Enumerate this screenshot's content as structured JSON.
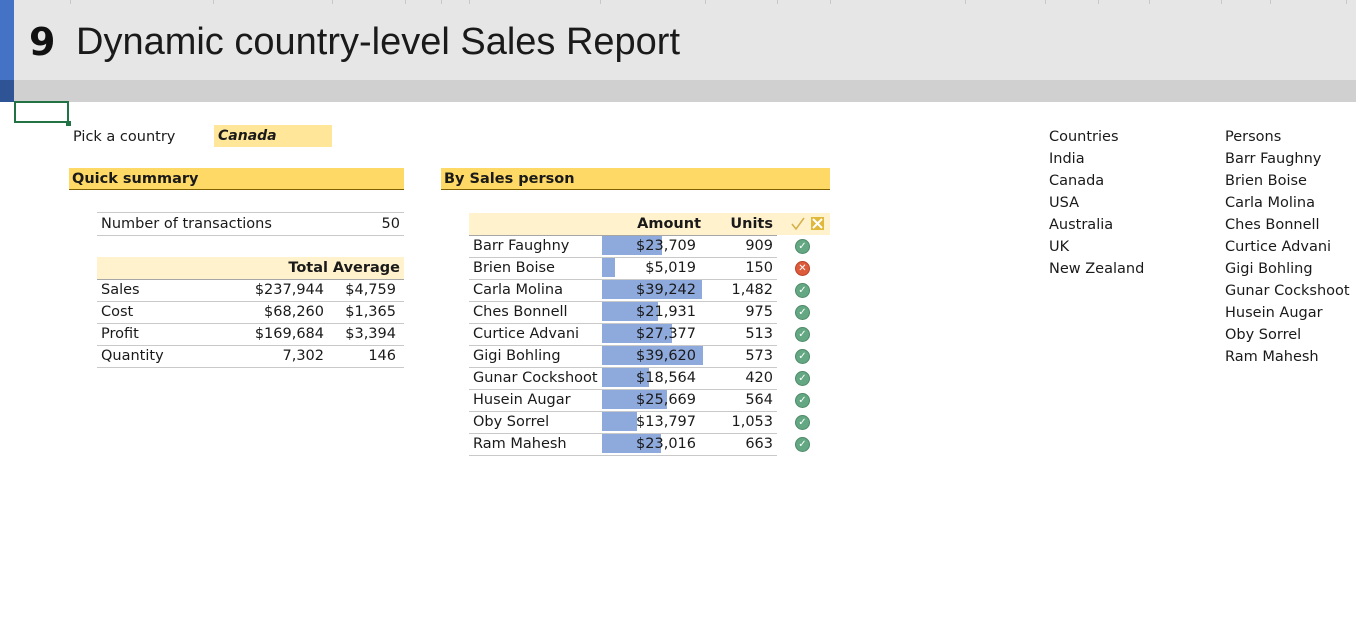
{
  "title": {
    "number": "9",
    "text": "Dynamic country-level Sales Report"
  },
  "picker": {
    "label": "Pick a country",
    "value": "Canada"
  },
  "quick_summary": {
    "header": "Quick summary",
    "transactions_label": "Number of transactions",
    "transactions_value": "50",
    "col_total": "Total",
    "col_average": "Average",
    "rows": [
      {
        "label": "Sales",
        "total": "$237,944",
        "average": "$4,759"
      },
      {
        "label": "Cost",
        "total": "$68,260",
        "average": "$1,365"
      },
      {
        "label": "Profit",
        "total": "$169,684",
        "average": "$3,394"
      },
      {
        "label": "Quantity",
        "total": "7,302",
        "average": "146"
      }
    ]
  },
  "by_person": {
    "header": "By Sales person",
    "col_amount": "Amount",
    "col_units": "Units",
    "col_status_icon": "check-cross-icon",
    "rows": [
      {
        "name": "Barr Faughny",
        "amount": "$23,709",
        "amount_value": 23709,
        "units": "909",
        "status": "ok"
      },
      {
        "name": "Brien Boise",
        "amount": "$5,019",
        "amount_value": 5019,
        "units": "150",
        "status": "bad"
      },
      {
        "name": "Carla Molina",
        "amount": "$39,242",
        "amount_value": 39242,
        "units": "1,482",
        "status": "ok"
      },
      {
        "name": "Ches Bonnell",
        "amount": "$21,931",
        "amount_value": 21931,
        "units": "975",
        "status": "ok"
      },
      {
        "name": "Curtice Advani",
        "amount": "$27,377",
        "amount_value": 27377,
        "units": "513",
        "status": "ok"
      },
      {
        "name": "Gigi Bohling",
        "amount": "$39,620",
        "amount_value": 39620,
        "units": "573",
        "status": "ok"
      },
      {
        "name": "Gunar Cockshoot",
        "amount": "$18,564",
        "amount_value": 18564,
        "units": "420",
        "status": "ok"
      },
      {
        "name": "Husein Augar",
        "amount": "$25,669",
        "amount_value": 25669,
        "units": "564",
        "status": "ok"
      },
      {
        "name": "Oby Sorrel",
        "amount": "$13,797",
        "amount_value": 13797,
        "units": "1,053",
        "status": "ok"
      },
      {
        "name": "Ram Mahesh",
        "amount": "$23,016",
        "amount_value": 23016,
        "units": "663",
        "status": "ok"
      }
    ]
  },
  "countries": {
    "header": "Countries",
    "items": [
      "India",
      "Canada",
      "USA",
      "Australia",
      "UK",
      "New Zealand"
    ]
  },
  "persons": {
    "header": "Persons",
    "items": [
      "Barr Faughny",
      "Brien Boise",
      "Carla Molina",
      "Ches Bonnell",
      "Curtice Advani",
      "Gigi Bohling",
      "Gunar Cockshoot",
      "Husein Augar",
      "Oby Sorrel",
      "Ram Mahesh"
    ]
  },
  "colors": {
    "accent": "#4472c4",
    "section_header": "#ffd966",
    "picker_fill": "#ffe699",
    "databar": "#8ea9db",
    "ok": "#63a883",
    "bad": "#dd5a3a"
  }
}
